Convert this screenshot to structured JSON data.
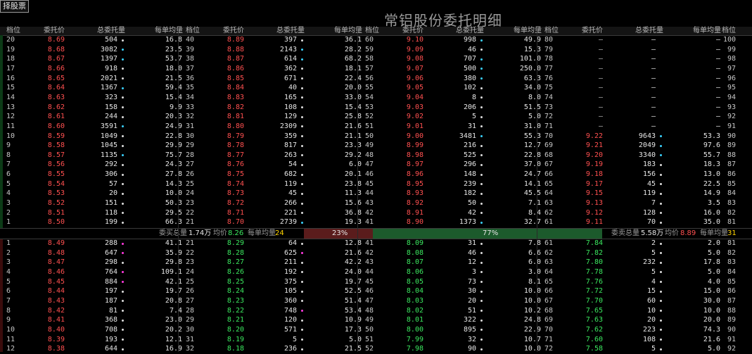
{
  "toolbar": {
    "stock_button": "择股票"
  },
  "window": {
    "title": "常铝股份委托明细"
  },
  "columns": {
    "level": "档位",
    "price": "委托价",
    "total": "总委托量",
    "avg": "每单均量"
  },
  "colors": {
    "sell": "#ff5050",
    "buy": "#3be85f",
    "neutral": "#c8c8c8",
    "sell_bar": "#5a1c1c",
    "buy_bar": "#1c5a2c",
    "dot_white": "#dcdcdc",
    "dot_cyan": "#3ad2ff",
    "dot_magenta": "#ff3adf"
  },
  "sell_rows": [
    [
      [
        "20",
        "8.69",
        "504",
        "w",
        "16.8"
      ],
      [
        "40",
        "8.89",
        "397",
        "w",
        "36.1"
      ],
      [
        "60",
        "9.10",
        "998",
        "c",
        "49.9"
      ],
      [
        "80",
        "—",
        "—",
        "",
        "—"
      ],
      [
        "100"
      ]
    ],
    [
      [
        "19",
        "8.68",
        "3082",
        "c",
        "23.5"
      ],
      [
        "39",
        "8.88",
        "2143",
        "c",
        "28.2"
      ],
      [
        "59",
        "9.09",
        "46",
        "w",
        "15.3"
      ],
      [
        "79",
        "—",
        "—",
        "",
        "—"
      ],
      [
        "99"
      ]
    ],
    [
      [
        "18",
        "8.67",
        "1397",
        "c",
        "53.7"
      ],
      [
        "38",
        "8.87",
        "614",
        "c",
        "68.2"
      ],
      [
        "58",
        "9.08",
        "707",
        "c",
        "101.0"
      ],
      [
        "78",
        "—",
        "—",
        "",
        "—"
      ],
      [
        "98"
      ]
    ],
    [
      [
        "17",
        "8.66",
        "918",
        "w",
        "18.0"
      ],
      [
        "37",
        "8.86",
        "362",
        "w",
        "18.1"
      ],
      [
        "57",
        "9.07",
        "500",
        "c",
        "250.0"
      ],
      [
        "77",
        "—",
        "—",
        "",
        "—"
      ],
      [
        "97"
      ]
    ],
    [
      [
        "16",
        "8.65",
        "2021",
        "w",
        "21.5"
      ],
      [
        "36",
        "8.85",
        "671",
        "w",
        "22.4"
      ],
      [
        "56",
        "9.06",
        "380",
        "c",
        "63.3"
      ],
      [
        "76",
        "—",
        "—",
        "",
        "—"
      ],
      [
        "96"
      ]
    ],
    [
      [
        "15",
        "8.64",
        "1367",
        "c",
        "59.4"
      ],
      [
        "35",
        "8.84",
        "40",
        "w",
        "20.0"
      ],
      [
        "55",
        "9.05",
        "102",
        "w",
        "34.0"
      ],
      [
        "75",
        "—",
        "—",
        "",
        "—"
      ],
      [
        "95"
      ]
    ],
    [
      [
        "14",
        "8.63",
        "323",
        "w",
        "15.4"
      ],
      [
        "34",
        "8.83",
        "165",
        "w",
        "33.0"
      ],
      [
        "54",
        "9.04",
        "8",
        "w",
        "8.0"
      ],
      [
        "74",
        "—",
        "—",
        "",
        "—"
      ],
      [
        "94"
      ]
    ],
    [
      [
        "13",
        "8.62",
        "158",
        "w",
        "9.9"
      ],
      [
        "33",
        "8.82",
        "108",
        "w",
        "15.4"
      ],
      [
        "53",
        "9.03",
        "206",
        "w",
        "51.5"
      ],
      [
        "73",
        "—",
        "—",
        "",
        "—"
      ],
      [
        "93"
      ]
    ],
    [
      [
        "12",
        "8.61",
        "244",
        "w",
        "20.3"
      ],
      [
        "32",
        "8.81",
        "129",
        "w",
        "25.8"
      ],
      [
        "52",
        "9.02",
        "5",
        "w",
        "5.0"
      ],
      [
        "72",
        "—",
        "—",
        "",
        "—"
      ],
      [
        "92"
      ]
    ],
    [
      [
        "11",
        "8.60",
        "3591",
        "c",
        "24.9"
      ],
      [
        "31",
        "8.80",
        "2309",
        "w",
        "21.6"
      ],
      [
        "51",
        "9.01",
        "31",
        "w",
        "31.0"
      ],
      [
        "71",
        "—",
        "—",
        "",
        "—"
      ],
      [
        "91"
      ]
    ],
    [
      [
        "10",
        "8.59",
        "1049",
        "w",
        "22.8"
      ],
      [
        "30",
        "8.79",
        "359",
        "w",
        "21.1"
      ],
      [
        "50",
        "9.00",
        "3481",
        "c",
        "55.3"
      ],
      [
        "70",
        "9.22",
        "9643",
        "c",
        "53.3"
      ],
      [
        "90"
      ]
    ],
    [
      [
        "9",
        "8.58",
        "1045",
        "w",
        "29.9"
      ],
      [
        "29",
        "8.78",
        "817",
        "w",
        "23.3"
      ],
      [
        "49",
        "8.99",
        "216",
        "w",
        "12.7"
      ],
      [
        "69",
        "9.21",
        "2049",
        "c",
        "97.6"
      ],
      [
        "89"
      ]
    ],
    [
      [
        "8",
        "8.57",
        "1135",
        "c",
        "75.7"
      ],
      [
        "28",
        "8.77",
        "263",
        "w",
        "29.2"
      ],
      [
        "48",
        "8.98",
        "525",
        "w",
        "22.8"
      ],
      [
        "68",
        "9.20",
        "3340",
        "c",
        "55.7"
      ],
      [
        "88"
      ]
    ],
    [
      [
        "7",
        "8.56",
        "292",
        "w",
        "24.3"
      ],
      [
        "27",
        "8.76",
        "54",
        "w",
        "6.0"
      ],
      [
        "47",
        "8.97",
        "296",
        "w",
        "37.0"
      ],
      [
        "67",
        "9.19",
        "183",
        "w",
        "18.3"
      ],
      [
        "87"
      ]
    ],
    [
      [
        "6",
        "8.55",
        "306",
        "w",
        "27.8"
      ],
      [
        "26",
        "8.75",
        "682",
        "w",
        "20.1"
      ],
      [
        "46",
        "8.96",
        "148",
        "w",
        "24.7"
      ],
      [
        "66",
        "9.18",
        "156",
        "w",
        "13.0"
      ],
      [
        "86"
      ]
    ],
    [
      [
        "5",
        "8.54",
        "57",
        "w",
        "14.3"
      ],
      [
        "25",
        "8.74",
        "119",
        "w",
        "23.8"
      ],
      [
        "45",
        "8.95",
        "239",
        "w",
        "14.1"
      ],
      [
        "65",
        "9.17",
        "45",
        "w",
        "22.5"
      ],
      [
        "85"
      ]
    ],
    [
      [
        "4",
        "8.53",
        "20",
        "w",
        "10.0"
      ],
      [
        "24",
        "8.73",
        "45",
        "w",
        "11.3"
      ],
      [
        "44",
        "8.93",
        "182",
        "w",
        "45.5"
      ],
      [
        "64",
        "9.15",
        "119",
        "w",
        "14.9"
      ],
      [
        "84"
      ]
    ],
    [
      [
        "3",
        "8.52",
        "151",
        "w",
        "50.3"
      ],
      [
        "23",
        "8.72",
        "266",
        "w",
        "15.6"
      ],
      [
        "43",
        "8.92",
        "50",
        "w",
        "7.1"
      ],
      [
        "63",
        "9.13",
        "7",
        "w",
        "3.5"
      ],
      [
        "83"
      ]
    ],
    [
      [
        "2",
        "8.51",
        "118",
        "w",
        "29.5"
      ],
      [
        "22",
        "8.71",
        "221",
        "w",
        "36.8"
      ],
      [
        "42",
        "8.91",
        "42",
        "w",
        "8.4"
      ],
      [
        "62",
        "9.12",
        "128",
        "w",
        "16.0"
      ],
      [
        "82"
      ]
    ],
    [
      [
        "1",
        "8.50",
        "199",
        "w",
        "66.3"
      ],
      [
        "21",
        "8.70",
        "2739",
        "c",
        "19.3"
      ],
      [
        "41",
        "8.90",
        "1373",
        "c",
        "32.7"
      ],
      [
        "61",
        "9.11",
        "70",
        "w",
        "35.0"
      ],
      [
        "81"
      ]
    ]
  ],
  "summary": {
    "buy_total_label": "委买总量",
    "buy_total": "1.74万",
    "buy_avg_price_label": "均价",
    "buy_avg_price": "8.26",
    "buy_per_order_label": "每单均量",
    "buy_per_order": "24",
    "buy_pct": "23%",
    "sell_pct": "77%",
    "sell_total_label": "委卖总量",
    "sell_total": "5.58万",
    "sell_avg_price_label": "均价",
    "sell_avg_price": "8.89",
    "sell_per_order_label": "每单均量",
    "sell_per_order": "31",
    "buy_ratio": 0.23
  },
  "buy_rows": [
    [
      [
        "1",
        "8.49",
        "288",
        "m",
        "41.1"
      ],
      [
        "21",
        "8.29",
        "64",
        "w",
        "12.8"
      ],
      [
        "41",
        "8.09",
        "31",
        "w",
        "7.8"
      ],
      [
        "61",
        "7.84",
        "2",
        "w",
        "2.0"
      ],
      [
        "81"
      ]
    ],
    [
      [
        "2",
        "8.48",
        "647",
        "m",
        "35.9"
      ],
      [
        "22",
        "8.28",
        "625",
        "m",
        "21.6"
      ],
      [
        "42",
        "8.08",
        "46",
        "w",
        "6.6"
      ],
      [
        "62",
        "7.82",
        "5",
        "w",
        "5.0"
      ],
      [
        "82"
      ]
    ],
    [
      [
        "3",
        "8.47",
        "298",
        "w",
        "29.8"
      ],
      [
        "23",
        "8.27",
        "211",
        "w",
        "42.2"
      ],
      [
        "43",
        "8.07",
        "12",
        "w",
        "6.0"
      ],
      [
        "63",
        "7.80",
        "232",
        "w",
        "17.8"
      ],
      [
        "83"
      ]
    ],
    [
      [
        "4",
        "8.46",
        "764",
        "m",
        "109.1"
      ],
      [
        "24",
        "8.26",
        "192",
        "w",
        "24.0"
      ],
      [
        "44",
        "8.06",
        "3",
        "w",
        "3.0"
      ],
      [
        "64",
        "7.78",
        "5",
        "w",
        "5.0"
      ],
      [
        "84"
      ]
    ],
    [
      [
        "5",
        "8.45",
        "884",
        "m",
        "42.1"
      ],
      [
        "25",
        "8.25",
        "375",
        "w",
        "19.7"
      ],
      [
        "45",
        "8.05",
        "73",
        "w",
        "8.1"
      ],
      [
        "65",
        "7.76",
        "4",
        "w",
        "4.0"
      ],
      [
        "85"
      ]
    ],
    [
      [
        "6",
        "8.44",
        "197",
        "w",
        "19.7"
      ],
      [
        "26",
        "8.24",
        "105",
        "w",
        "52.5"
      ],
      [
        "46",
        "8.04",
        "30",
        "w",
        "10.0"
      ],
      [
        "66",
        "7.72",
        "15",
        "w",
        "15.0"
      ],
      [
        "86"
      ]
    ],
    [
      [
        "7",
        "8.43",
        "187",
        "w",
        "20.8"
      ],
      [
        "27",
        "8.23",
        "360",
        "w",
        "51.4"
      ],
      [
        "47",
        "8.03",
        "20",
        "w",
        "10.0"
      ],
      [
        "67",
        "7.70",
        "60",
        "w",
        "30.0"
      ],
      [
        "87"
      ]
    ],
    [
      [
        "8",
        "8.42",
        "81",
        "w",
        "7.4"
      ],
      [
        "28",
        "8.22",
        "748",
        "m",
        "53.4"
      ],
      [
        "48",
        "8.02",
        "51",
        "w",
        "10.2"
      ],
      [
        "68",
        "7.65",
        "10",
        "w",
        "10.0"
      ],
      [
        "88"
      ]
    ],
    [
      [
        "9",
        "8.41",
        "368",
        "w",
        "23.0"
      ],
      [
        "29",
        "8.21",
        "120",
        "w",
        "10.9"
      ],
      [
        "49",
        "8.01",
        "322",
        "w",
        "24.8"
      ],
      [
        "69",
        "7.63",
        "20",
        "w",
        "20.0"
      ],
      [
        "89"
      ]
    ],
    [
      [
        "10",
        "8.40",
        "708",
        "w",
        "20.2"
      ],
      [
        "30",
        "8.20",
        "571",
        "w",
        "17.3"
      ],
      [
        "50",
        "8.00",
        "895",
        "w",
        "22.9"
      ],
      [
        "70",
        "7.62",
        "223",
        "w",
        "74.3"
      ],
      [
        "90"
      ]
    ],
    [
      [
        "11",
        "8.39",
        "193",
        "w",
        "12.1"
      ],
      [
        "31",
        "8.19",
        "5",
        "w",
        "5.0"
      ],
      [
        "51",
        "7.99",
        "32",
        "w",
        "10.7"
      ],
      [
        "71",
        "7.60",
        "108",
        "w",
        "21.6"
      ],
      [
        "91"
      ]
    ],
    [
      [
        "12",
        "8.38",
        "644",
        "w",
        "16.9"
      ],
      [
        "32",
        "8.18",
        "236",
        "w",
        "21.5"
      ],
      [
        "52",
        "7.98",
        "90",
        "w",
        "10.0"
      ],
      [
        "72",
        "7.58",
        "5",
        "w",
        "5.0"
      ],
      [
        "92"
      ]
    ]
  ]
}
